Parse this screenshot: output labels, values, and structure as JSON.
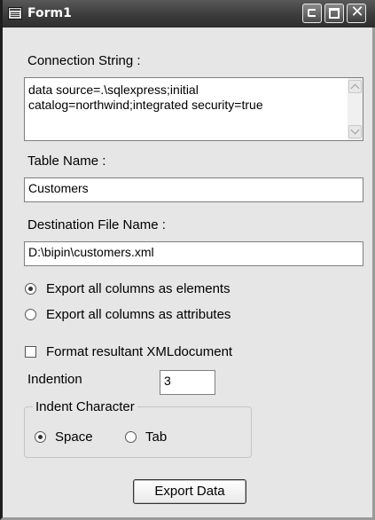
{
  "window": {
    "title": "Form1",
    "controls": {
      "minimize": "minimize-icon",
      "maximize": "maximize-icon",
      "close": "close-icon",
      "close_glyph": "✕"
    }
  },
  "connection": {
    "label": "Connection String :",
    "value": "data source=.\\sqlexpress;initial catalog=northwind;integrated security=true"
  },
  "table": {
    "label": "Table Name :",
    "value": "Customers"
  },
  "destination": {
    "label": "Destination File Name :",
    "value": "D:\\bipin\\customers.xml"
  },
  "export_mode": {
    "options": [
      {
        "label": "Export all columns as elements",
        "checked": true
      },
      {
        "label": "Export all columns as attributes",
        "checked": false
      }
    ]
  },
  "format": {
    "label": "Format resultant XMLdocument",
    "checked": false
  },
  "indention": {
    "label": "Indention",
    "value": "3"
  },
  "indent_char": {
    "legend": "Indent Character",
    "options": [
      {
        "label": "Space",
        "checked": true
      },
      {
        "label": "Tab",
        "checked": false
      }
    ]
  },
  "actions": {
    "export_label": "Export Data"
  }
}
